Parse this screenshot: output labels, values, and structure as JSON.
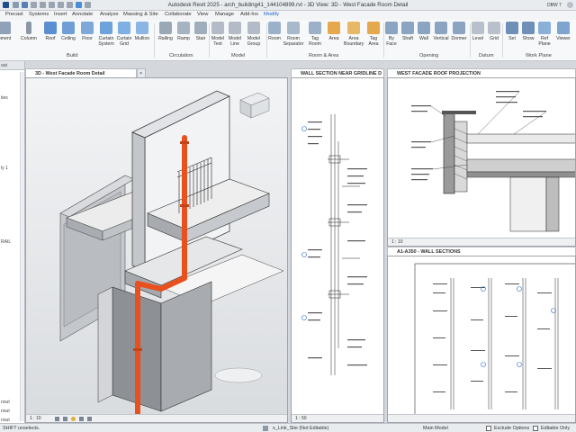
{
  "window": {
    "title": "Autodesk Revit 2025 - arch_building41_144104899.rvt - 3D View: 3D - West Facade Room Detail",
    "user": "DBW 7"
  },
  "menu": [
    "Precast",
    "Systems",
    "Insert",
    "Annotate",
    "Analyze",
    "Massing & Site",
    "Collaborate",
    "View",
    "Manage",
    "Add-Ins",
    "Modify"
  ],
  "ribbon": {
    "buttons": [
      "oment",
      "Column",
      "Roof",
      "Ceiling",
      "Floor",
      "Curtain\nSystem",
      "Curtain\nGrid",
      "Mullion",
      "Railing",
      "Ramp",
      "Stair",
      "Model\nText",
      "Model\nLine",
      "Model\nGroup",
      "Room",
      "Room\nSeparator",
      "Tag\nRoom",
      "Area",
      "Area\nBoundary",
      "Tag\nArea",
      "By\nFace",
      "Shaft",
      "Wall",
      "Vertical",
      "Dormer",
      "Level",
      "Grid",
      "Set",
      "Show",
      "Ref\nPlane",
      "Viewer"
    ],
    "panels": [
      "Build",
      "Circulation",
      "Model",
      "Room & Area",
      "Opening",
      "Datum",
      "Work Plane"
    ]
  },
  "left_panel": {
    "header": "out",
    "rows": [
      "ties",
      "",
      "ly 1",
      "",
      "",
      "",
      "",
      "",
      "",
      "RAIL",
      "",
      "",
      "",
      "",
      "",
      "",
      "",
      "",
      "",
      "",
      "",
      "",
      "",
      "",
      "",
      "",
      "",
      "",
      "",
      "",
      "",
      "",
      "",
      "",
      "",
      "",
      "nout",
      "nout",
      "nout"
    ]
  },
  "views": [
    {
      "tab": "3D - West Facade Room Detail",
      "scale": "1 : 10"
    },
    {
      "tab": "WALL SECTION NEAR GRIDLINE D",
      "scale": "1 : 50"
    },
    {
      "tab": "WEST FACADE ROOF PROJECTION",
      "scale": "1 : 10"
    },
    {
      "tab": "A1-A350 - WALL SECTIONS",
      "scale": ""
    }
  ],
  "status": {
    "left": "SHIFT unselects.",
    "link": "s_Link_Site (Not Editable)",
    "model": "Main Model",
    "exclude": "Exclude Options",
    "editable": "Editable Only"
  },
  "colors": {
    "pipe": "#e8501e",
    "accent": "#1c62c9",
    "ribbon_blue": "#4a8fd6"
  }
}
